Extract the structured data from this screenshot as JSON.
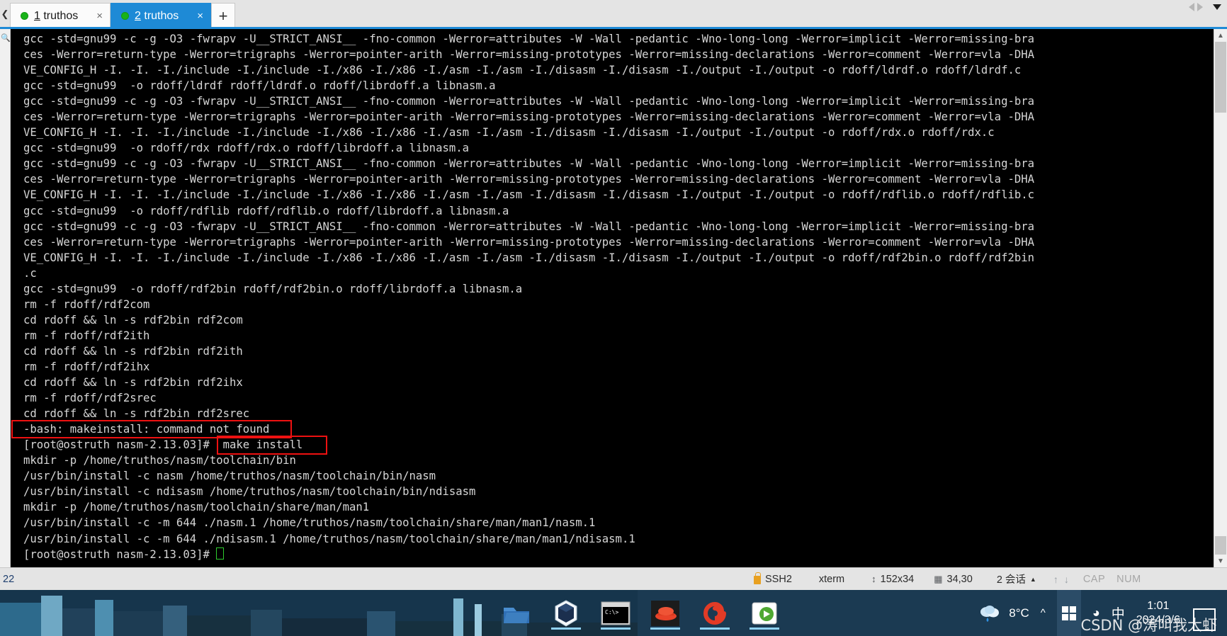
{
  "tabbar": {
    "scroll_left_icon": "chevron-left-icon",
    "tabs": [
      {
        "index": "1",
        "label": " truthos",
        "status": "connected",
        "close_label": "×",
        "active": false
      },
      {
        "index": "2",
        "label": " truthos",
        "status": "connected",
        "close_label": "×",
        "active": true
      }
    ],
    "new_tab_label": "+",
    "nav_prev_icon": "triangle-left-icon",
    "nav_next_icon": "triangle-right-icon",
    "nav_menu_icon": "triangle-down-icon"
  },
  "terminal": {
    "gutter_icon": "search-icon",
    "lines": [
      "gcc -std=gnu99 -c -g -O3 -fwrapv -U__STRICT_ANSI__ -fno-common -Werror=attributes -W -Wall -pedantic -Wno-long-long -Werror=implicit -Werror=missing-bra",
      "ces -Werror=return-type -Werror=trigraphs -Werror=pointer-arith -Werror=missing-prototypes -Werror=missing-declarations -Werror=comment -Werror=vla -DHA",
      "VE_CONFIG_H -I. -I. -I./include -I./include -I./x86 -I./x86 -I./asm -I./asm -I./disasm -I./disasm -I./output -I./output -o rdoff/ldrdf.o rdoff/ldrdf.c",
      "gcc -std=gnu99  -o rdoff/ldrdf rdoff/ldrdf.o rdoff/librdoff.a libnasm.a",
      "gcc -std=gnu99 -c -g -O3 -fwrapv -U__STRICT_ANSI__ -fno-common -Werror=attributes -W -Wall -pedantic -Wno-long-long -Werror=implicit -Werror=missing-bra",
      "ces -Werror=return-type -Werror=trigraphs -Werror=pointer-arith -Werror=missing-prototypes -Werror=missing-declarations -Werror=comment -Werror=vla -DHA",
      "VE_CONFIG_H -I. -I. -I./include -I./include -I./x86 -I./x86 -I./asm -I./asm -I./disasm -I./disasm -I./output -I./output -o rdoff/rdx.o rdoff/rdx.c",
      "gcc -std=gnu99  -o rdoff/rdx rdoff/rdx.o rdoff/librdoff.a libnasm.a",
      "gcc -std=gnu99 -c -g -O3 -fwrapv -U__STRICT_ANSI__ -fno-common -Werror=attributes -W -Wall -pedantic -Wno-long-long -Werror=implicit -Werror=missing-bra",
      "ces -Werror=return-type -Werror=trigraphs -Werror=pointer-arith -Werror=missing-prototypes -Werror=missing-declarations -Werror=comment -Werror=vla -DHA",
      "VE_CONFIG_H -I. -I. -I./include -I./include -I./x86 -I./x86 -I./asm -I./asm -I./disasm -I./disasm -I./output -I./output -o rdoff/rdflib.o rdoff/rdflib.c",
      "gcc -std=gnu99  -o rdoff/rdflib rdoff/rdflib.o rdoff/librdoff.a libnasm.a",
      "gcc -std=gnu99 -c -g -O3 -fwrapv -U__STRICT_ANSI__ -fno-common -Werror=attributes -W -Wall -pedantic -Wno-long-long -Werror=implicit -Werror=missing-bra",
      "ces -Werror=return-type -Werror=trigraphs -Werror=pointer-arith -Werror=missing-prototypes -Werror=missing-declarations -Werror=comment -Werror=vla -DHA",
      "VE_CONFIG_H -I. -I. -I./include -I./include -I./x86 -I./x86 -I./asm -I./asm -I./disasm -I./disasm -I./output -I./output -o rdoff/rdf2bin.o rdoff/rdf2bin",
      ".c",
      "gcc -std=gnu99  -o rdoff/rdf2bin rdoff/rdf2bin.o rdoff/librdoff.a libnasm.a",
      "rm -f rdoff/rdf2com",
      "cd rdoff && ln -s rdf2bin rdf2com",
      "rm -f rdoff/rdf2ith",
      "cd rdoff && ln -s rdf2bin rdf2ith",
      "rm -f rdoff/rdf2ihx",
      "cd rdoff && ln -s rdf2bin rdf2ihx",
      "rm -f rdoff/rdf2srec",
      "cd rdoff && ln -s rdf2bin rdf2srec",
      "-bash: makeinstall: command not found",
      "[root@ostruth nasm-2.13.03]#  make install",
      "mkdir -p /home/truthos/nasm/toolchain/bin",
      "/usr/bin/install -c nasm /home/truthos/nasm/toolchain/bin/nasm",
      "/usr/bin/install -c ndisasm /home/truthos/nasm/toolchain/bin/ndisasm",
      "mkdir -p /home/truthos/nasm/toolchain/share/man/man1",
      "/usr/bin/install -c -m 644 ./nasm.1 /home/truthos/nasm/toolchain/share/man/man1/nasm.1",
      "/usr/bin/install -c -m 644 ./ndisasm.1 /home/truthos/nasm/toolchain/share/man/man1/ndisasm.1",
      "[root@ostruth nasm-2.13.03]# "
    ],
    "annotations": [
      {
        "name": "error-highlight",
        "text": "-bash: makeinstall: command not found",
        "color": "#ee1111"
      },
      {
        "name": "command-highlight",
        "text": "make install",
        "color": "#ee1111"
      }
    ],
    "scrollbar": {
      "up_icon": "chevron-up-icon",
      "down_icon": "chevron-down-icon"
    }
  },
  "statusbar": {
    "left_text": "22",
    "protocol": "SSH2",
    "protocol_icon": "lock-icon",
    "emulation": "xterm",
    "size_icon": "resize-icon",
    "size": "152x34",
    "cursor_icon": "cursor-icon",
    "cursor_pos": "34,30",
    "sessions": "2 会话",
    "sessions_caret": "▲",
    "upload_icon": "arrow-up-icon",
    "download_icon": "arrow-down-icon",
    "caps": "CAP",
    "num": "NUM"
  },
  "taskbar": {
    "apps": [
      {
        "name": "file-explorer-icon",
        "glyph": ""
      },
      {
        "name": "virtualbox-icon",
        "glyph": ""
      },
      {
        "name": "command-prompt-icon",
        "glyph": ""
      },
      {
        "name": "redhat-icon",
        "glyph": ""
      },
      {
        "name": "xshell-icon",
        "glyph": ""
      },
      {
        "name": "xftp-icon",
        "glyph": ""
      }
    ],
    "tray": {
      "weather_icon": "rain-cloud-icon",
      "temperature": "8°C",
      "overflow_icon": "chevron-up-icon",
      "windows_icon": "windows-flag-icon",
      "network_icon": "wifi-icon",
      "ime": "中",
      "time": "1:01",
      "date": "2024/3/6"
    },
    "watermark": "CSDN @涛叫我大虾"
  }
}
